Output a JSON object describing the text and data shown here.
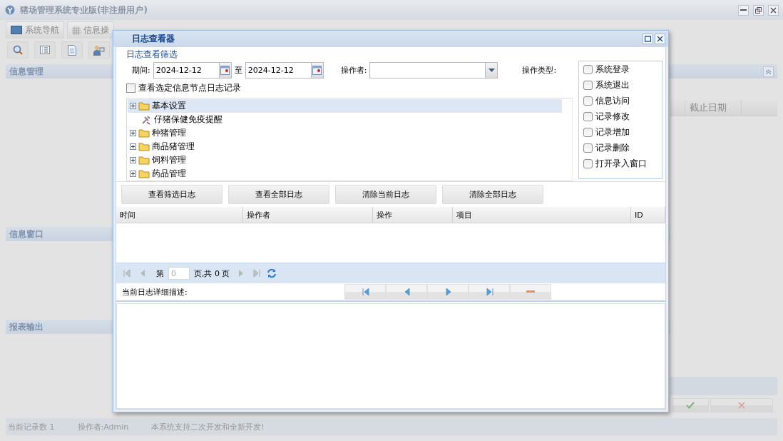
{
  "window": {
    "title": "猪场管理系统专业版(非注册用户)"
  },
  "tabs": [
    {
      "label": "系统导航"
    },
    {
      "label": "信息操"
    }
  ],
  "panels": [
    {
      "title": "信息管理"
    },
    {
      "title": "信息窗口"
    },
    {
      "title": "报表输出"
    }
  ],
  "grid": {
    "columns": [
      "截止日期"
    ]
  },
  "status_bar": [
    "当前记录数 1",
    "操作者:Admin",
    "本系统支持二次开发和全新开发!"
  ],
  "dialog": {
    "title": "日志查看器",
    "filter": {
      "legend": "日志查看筛选",
      "period_label": "期间:",
      "date_from": "2024-12-12",
      "to_label": "至",
      "date_to": "2024-12-12",
      "operator_label": "操作者:",
      "type_label": "操作类型:",
      "node_filter": {
        "label": "查看选定信息节点日志记录",
        "checked": false
      },
      "types": [
        {
          "label": "系统登录",
          "checked": false
        },
        {
          "label": "系统退出",
          "checked": false
        },
        {
          "label": "信息访问",
          "checked": false
        },
        {
          "label": "记录修改",
          "checked": false
        },
        {
          "label": "记录增加",
          "checked": false
        },
        {
          "label": "记录删除",
          "checked": false
        },
        {
          "label": "打开录入窗口",
          "checked": false
        }
      ]
    },
    "tree": [
      {
        "label": "基本设置",
        "kind": "folder",
        "expanded": false,
        "selected": true
      },
      {
        "label": "仔猪保健免疫提醒",
        "kind": "leaf",
        "selected": false
      },
      {
        "label": "种猪管理",
        "kind": "folder",
        "expanded": false,
        "selected": false
      },
      {
        "label": "商品猪管理",
        "kind": "folder",
        "expanded": false,
        "selected": false
      },
      {
        "label": "饲料管理",
        "kind": "folder",
        "expanded": false,
        "selected": false
      },
      {
        "label": "药品管理",
        "kind": "folder",
        "expanded": false,
        "selected": false
      }
    ],
    "buttons": [
      "查看筛选日志",
      "查看全部日志",
      "清除当前日志",
      "清除全部日志"
    ],
    "columns": [
      "时间",
      "操作者",
      "操作",
      "项目",
      "ID"
    ],
    "pager": {
      "page_label": "第",
      "page": "0",
      "total": "页,共 0 页"
    },
    "detail_label": "当前日志详细描述:"
  }
}
